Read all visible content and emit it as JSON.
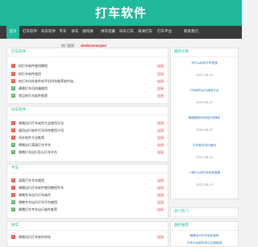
{
  "header": {
    "title": "打车软件"
  },
  "nav": [
    "首页",
    "打车软件",
    "叫车软件",
    "专车",
    "拼车",
    "顺风拼车",
    "拼车招募",
    "叫车订车",
    "滴滴打车",
    "打车平台",
    "联系我们"
  ],
  "search": {
    "label": "热门搜索：",
    "value": "dadarenwujee"
  },
  "sections": [
    {
      "title": "打车软件",
      "rows": [
        {
          "n": "1",
          "t": "拍打车软件使用教程",
          "a": "连接"
        },
        {
          "n": "2",
          "t": "拍打车软件使用",
          "a": "连接"
        },
        {
          "n": "3",
          "t": "拍打车叫车软件的手机叫车推荐软件连",
          "a": "连接"
        },
        {
          "n": "4",
          "t": "嘀嗒打车司机端使用",
          "a": "连接"
        },
        {
          "n": "5",
          "t": "常见的打车软件推荐",
          "a": "连接"
        }
      ]
    },
    {
      "title": "叫车软件",
      "rows": [
        {
          "n": "1",
          "t": "嘀嗒出行打车软件大全使用方法",
          "a": "连接"
        },
        {
          "n": "2",
          "t": "顺风出行软件打车叫车使用介绍",
          "a": "连接"
        },
        {
          "n": "3",
          "t": "叫车软件大全推荐",
          "a": "连接"
        },
        {
          "n": "4",
          "t": "嘀嗒出行滴滴打车专车",
          "a": "连接"
        },
        {
          "n": "5",
          "t": "嘀嗒打车出行怎么打车平台",
          "a": "连接"
        }
      ]
    },
    {
      "title": "专车",
      "rows": [
        {
          "n": "1",
          "t": "滴滴打车专车使用",
          "a": "连接"
        },
        {
          "n": "2",
          "t": "嘀嗒出行打车软件使用教程专车",
          "a": "连接"
        },
        {
          "n": "3",
          "t": "嘀嗒专车出行打车软件",
          "a": "连接"
        },
        {
          "n": "4",
          "t": "嘀嗒专车出行打车平台使用",
          "a": "连接"
        },
        {
          "n": "5",
          "t": "嘀嗒打车专车出行软件推荐",
          "a": "连接"
        }
      ]
    },
    {
      "title": "拼车",
      "rows": [
        {
          "n": "1",
          "t": "嘀嗒出行打车软件拼车",
          "a": "连接"
        }
      ]
    }
  ],
  "sidebar": {
    "recent_title": "最新文章",
    "recent": [
      {
        "t": "为什么用车打车快速",
        "d": "2022-08-15"
      },
      {
        "t": "打车软件出行使用方法",
        "d": "2022-08-15"
      },
      {
        "t": "嘀嗒顺风车司机打车操作",
        "d": "2022-08-15"
      },
      {
        "t": "打车软件出行使用",
        "d": "2022-08-15"
      },
      {
        "t": "一嗒什么的打车软件推荐",
        "d": "2022-08-15"
      }
    ],
    "hot_title": "热门热门",
    "links_title": "随机推荐",
    "links": [
      {
        "t": "嘀嗒出行打车软件推荐"
      },
      {
        "t": "打车平台软件怎么注册使用"
      }
    ]
  }
}
